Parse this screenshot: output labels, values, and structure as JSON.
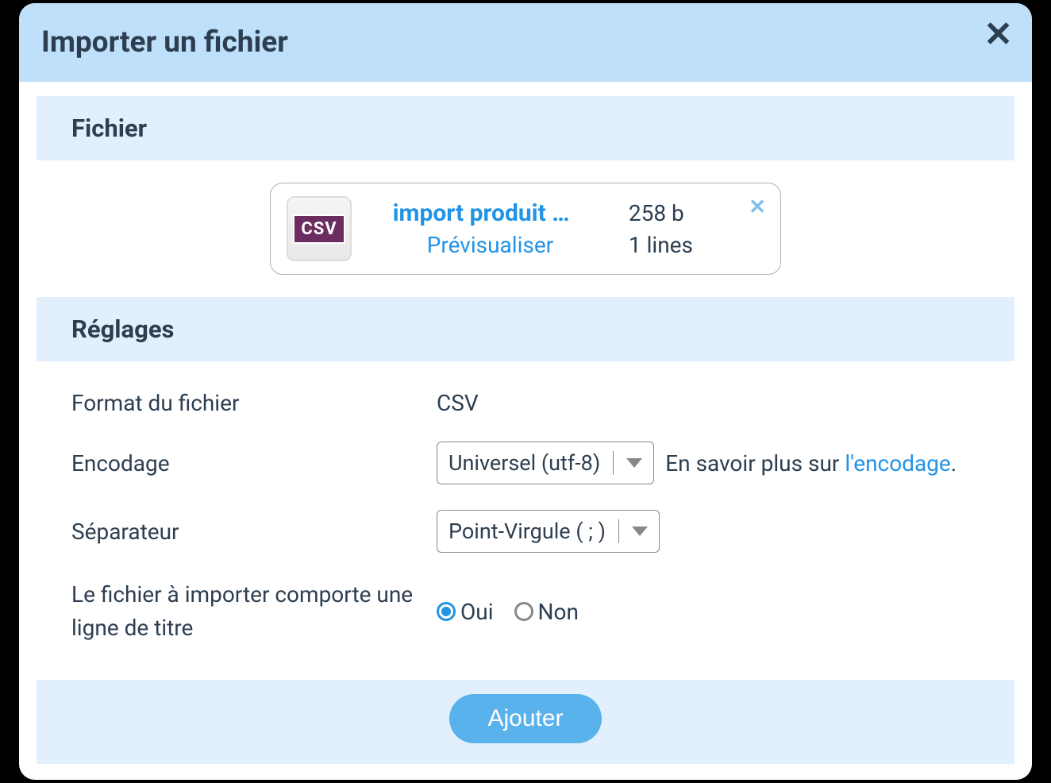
{
  "modal": {
    "title": "Importer un fichier"
  },
  "sections": {
    "file": {
      "heading": "Fichier",
      "uploaded": {
        "icon_label": "CSV",
        "name": "import produit …",
        "size": "258 b",
        "preview_label": "Prévisualiser",
        "lines": "1 lines"
      }
    },
    "settings": {
      "heading": "Réglages",
      "format": {
        "label": "Format du fichier",
        "value": "CSV"
      },
      "encoding": {
        "label": "Encodage",
        "selected": "Universel (utf-8)",
        "hint_prefix": "En savoir plus sur ",
        "hint_link": "l'encodage",
        "hint_suffix": "."
      },
      "separator": {
        "label": "Séparateur",
        "selected": "Point-Virgule ( ; )"
      },
      "title_line": {
        "label": "Le fichier à importer comporte une ligne de titre",
        "yes": "Oui",
        "no": "Non",
        "selected": "yes"
      }
    }
  },
  "actions": {
    "submit": "Ajouter"
  }
}
